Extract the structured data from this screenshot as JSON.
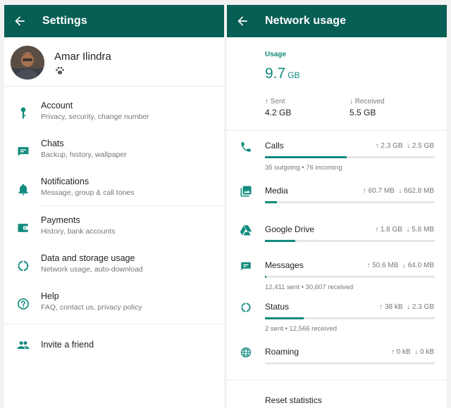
{
  "settings": {
    "title": "Settings",
    "profile": {
      "name": "Amar Ilindra"
    },
    "items": [
      {
        "title": "Account",
        "subtitle": "Privacy, security, change number"
      },
      {
        "title": "Chats",
        "subtitle": "Backup, history, wallpaper"
      },
      {
        "title": "Notifications",
        "subtitle": "Message, group & call tones"
      },
      {
        "title": "Payments",
        "subtitle": "History, bank accounts"
      },
      {
        "title": "Data and storage usage",
        "subtitle": "Network usage, auto-download"
      },
      {
        "title": "Help",
        "subtitle": "FAQ, contact us, privacy policy"
      }
    ],
    "invite": "Invite a friend"
  },
  "network": {
    "title": "Network usage",
    "usage_label": "Usage",
    "total_value": "9.7",
    "total_unit": "GB",
    "sent_label": "↑ Sent",
    "sent_value": "4.2 GB",
    "received_label": "↓ Received",
    "received_value": "5.5 GB",
    "rows": [
      {
        "name": "Calls",
        "up": "↑ 2.3 GB",
        "down": "↓ 2.5 GB",
        "fraction": 0.48,
        "detail": "35 outgoing • 76 incoming"
      },
      {
        "name": "Media",
        "up": "↑ 60.7 MB",
        "down": "↓ 662.8 MB",
        "fraction": 0.07
      },
      {
        "name": "Google Drive",
        "up": "↑ 1.8 GB",
        "down": "↓ 5.8 MB",
        "fraction": 0.18
      },
      {
        "name": "Messages",
        "up": "↑ 50.6 MB",
        "down": "↓ 64.0 MB",
        "fraction": 0.01,
        "detail": "12,411 sent • 30,607 received"
      },
      {
        "name": "Status",
        "up": "↑ 38 kB",
        "down": "↓ 2.3 GB",
        "fraction": 0.23,
        "detail": "2 sent • 12,566 received"
      },
      {
        "name": "Roaming",
        "up": "↑ 0 kB",
        "down": "↓ 0 kB",
        "fraction": 0
      }
    ],
    "reset": "Reset statistics"
  },
  "colors": {
    "appbar": "#075e54",
    "accent": "#128c7e",
    "icon": "#128c7e"
  }
}
